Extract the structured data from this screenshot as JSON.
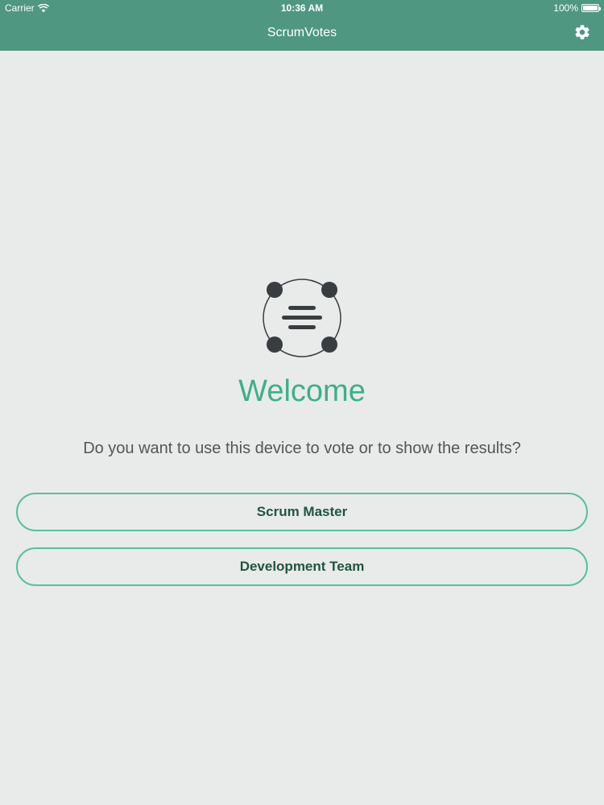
{
  "status_bar": {
    "carrier": "Carrier",
    "time": "10:36 AM",
    "battery": "100%"
  },
  "navbar": {
    "title": "ScrumVotes",
    "settings_icon": "gear-icon"
  },
  "logo_icon": "scrumvotes-logo-icon",
  "welcome": {
    "heading": "Welcome",
    "question": "Do you want to use this device to vote or to show the results?"
  },
  "buttons": {
    "scrum_master": "Scrum Master",
    "development_team": "Development Team"
  },
  "colors": {
    "navbar_bg": "#4f9781",
    "accent": "#3fae8a",
    "button_border": "#5cbf9b",
    "button_text": "#22543f",
    "background": "#e8ebea"
  }
}
